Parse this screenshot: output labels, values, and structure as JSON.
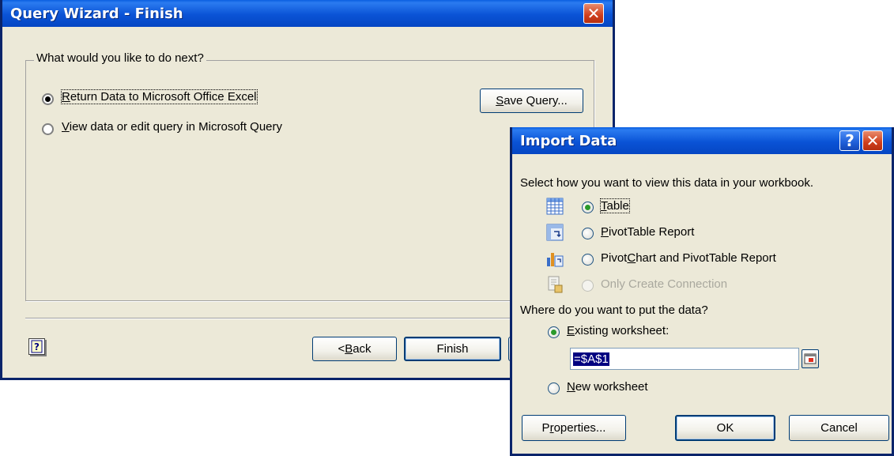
{
  "query_wizard": {
    "title": "Query Wizard - Finish",
    "group_label": "What would you like to do next?",
    "option_return": {
      "pre": "",
      "accel": "R",
      "post": "eturn Data to Microsoft Office Excel"
    },
    "option_view": {
      "pre": "",
      "accel": "V",
      "post": "iew data or edit query in Microsoft Query"
    },
    "save_query": {
      "pre": "",
      "accel": "S",
      "post": "ave Query..."
    },
    "back": {
      "pre": "< ",
      "accel": "B",
      "post": "ack"
    },
    "finish_label": "Finish",
    "help_icon": "question-book-icon",
    "close_glyph": "✕"
  },
  "import_data": {
    "title": "Import Data",
    "help_glyph": "?",
    "close_glyph": "✕",
    "prompt_view": "Select how you want to view this data in your workbook.",
    "opt_table": {
      "pre": "",
      "accel": "T",
      "post": "able"
    },
    "opt_pivot": {
      "pre": "",
      "accel": "P",
      "post": "ivotTable Report"
    },
    "opt_pivotchart": {
      "pre": "Pivot",
      "accel": "C",
      "post": "hart and PivotTable Report"
    },
    "opt_connection": "Only Create Connection",
    "prompt_where": "Where do you want to put the data?",
    "existing": {
      "pre": "",
      "accel": "E",
      "post": "xisting worksheet:"
    },
    "range_value": "=$A$1",
    "new_ws": {
      "pre": "",
      "accel": "N",
      "post": "ew worksheet"
    },
    "properties": {
      "pre": "P",
      "accel": "r",
      "post": "operties..."
    },
    "ok_label": "OK",
    "cancel_label": "Cancel",
    "colors": {
      "title_blue": "#0a53d6",
      "face": "#ece9d8",
      "selection": "#000080"
    }
  }
}
